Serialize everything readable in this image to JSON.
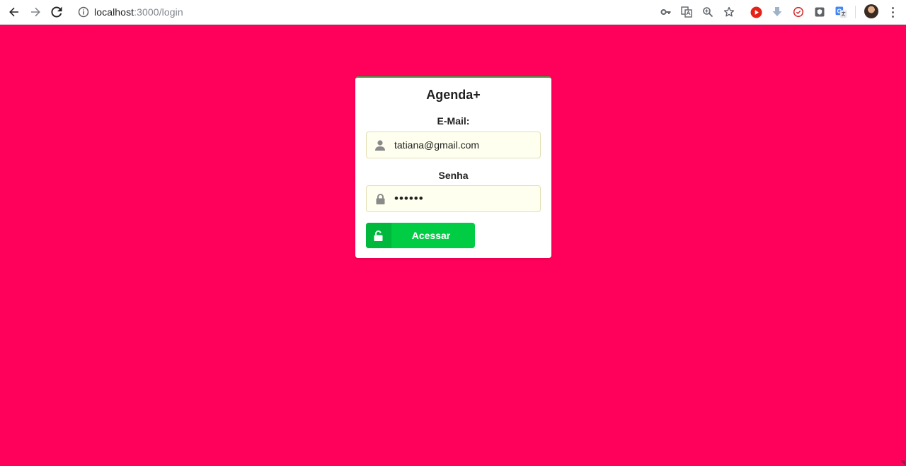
{
  "browser": {
    "url_host": "localhost",
    "url_path": ":3000/login"
  },
  "icons": {
    "back": "arrow-left-icon",
    "forward": "arrow-right-icon",
    "reload": "reload-icon",
    "info": "info-icon",
    "key": "key-icon",
    "translate": "translate-icon",
    "zoom": "zoom-icon",
    "bookmark": "star-icon",
    "user": "user-icon",
    "lock": "lock-icon",
    "unlock": "unlock-icon"
  },
  "colors": {
    "background": "#ff005a",
    "button": "#00cc44",
    "card_accent": "#21ba45",
    "input_bg": "#fffff0"
  },
  "login": {
    "title": "Agenda+",
    "email_label": "E-Mail:",
    "email_value": "tatiana@gmail.com",
    "password_label": "Senha",
    "password_value": "••••••",
    "submit_label": "Acessar"
  }
}
